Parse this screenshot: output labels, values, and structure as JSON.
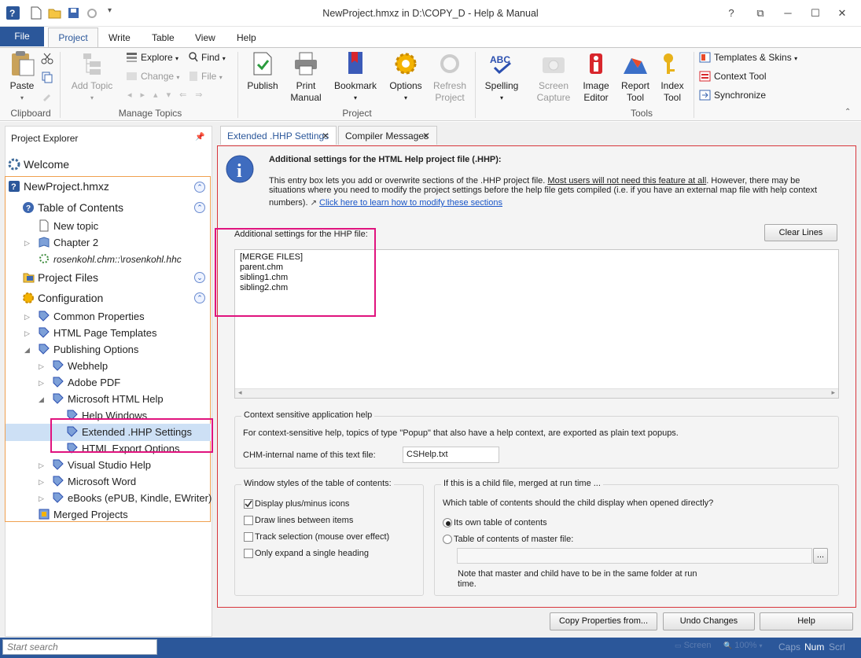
{
  "window": {
    "title": "NewProject.hmxz in D:\\COPY_D - Help & Manual",
    "help_btn": "?",
    "restore_btn": "⧉",
    "minimize_btn": "─",
    "maximize_btn": "☐",
    "close_btn": "✕"
  },
  "ribbon_tabs": {
    "file": "File",
    "project": "Project",
    "write": "Write",
    "table": "Table",
    "view": "View",
    "help": "Help"
  },
  "ribbon": {
    "clipboard": {
      "label": "Clipboard",
      "paste": "Paste"
    },
    "manage_topics": {
      "label": "Manage Topics",
      "add_topic": "Add Topic",
      "explore": "Explore",
      "find": "Find",
      "change": "Change",
      "file": "File"
    },
    "project": {
      "label": "Project",
      "publish": "Publish",
      "print_manual_1": "Print",
      "print_manual_2": "Manual",
      "bookmark": "Bookmark",
      "options": "Options",
      "refresh_1": "Refresh",
      "refresh_2": "Project"
    },
    "tools": {
      "label": "Tools",
      "spelling": "Spelling",
      "screen_capture_1": "Screen",
      "screen_capture_2": "Capture",
      "image_editor_1": "Image",
      "image_editor_2": "Editor",
      "report_tool_1": "Report",
      "report_tool_2": "Tool",
      "index_tool_1": "Index",
      "index_tool_2": "Tool",
      "templates_skins": "Templates & Skins",
      "context_tool": "Context Tool",
      "synchronize": "Synchronize"
    }
  },
  "explorer": {
    "title": "Project Explorer",
    "welcome": "Welcome",
    "project": "NewProject.hmxz",
    "toc": "Table of Contents",
    "new_topic": "New topic",
    "chapter2": "Chapter 2",
    "rosenkohl": "rosenkohl.chm::\\rosenkohl.hhc",
    "project_files": "Project Files",
    "configuration": "Configuration",
    "common_properties": "Common Properties",
    "html_page_templates": "HTML Page Templates",
    "publishing_options": "Publishing Options",
    "webhelp": "Webhelp",
    "adobe_pdf": "Adobe PDF",
    "ms_html_help": "Microsoft HTML Help",
    "help_windows": "Help Windows",
    "extended_hhp": "Extended .HHP Settings",
    "html_export": "HTML Export Options",
    "visual_studio_help": "Visual Studio Help",
    "ms_word": "Microsoft Word",
    "ebooks": "eBooks (ePUB, Kindle, EWriter)",
    "merged_projects": "Merged Projects"
  },
  "doc_tabs": {
    "extended": "Extended .HHP Settings",
    "compiler": "Compiler Messages"
  },
  "content": {
    "heading": "Additional settings for the HTML Help project file (.HHP):",
    "desc_1": "This entry box lets you add or overwrite sections of the .HHP project file.",
    "desc_underlined": "Most users will not need this feature at all",
    "desc_2": ". However, there may be",
    "desc_3": "situations where you need to modify the project settings before the help file gets compiled (i.e. if you have an external map file with help context",
    "desc_4": "numbers).",
    "desc_link": "Click here to learn how to modify these sections",
    "hhp_label": "Additional settings for the HHP file:",
    "clear_lines": "Clear Lines",
    "hhp_lines": [
      "[MERGE FILES]",
      "parent.chm",
      "sibling1.chm",
      "sibling2.chm"
    ],
    "context_group": "Context sensitive application help",
    "context_desc": "For context-sensitive help, topics of type \"Popup\" that also have a help context, are exported as plain text popups.",
    "chm_internal_label": "CHM-internal name of this text file:",
    "chm_internal_value": "CSHelp.txt",
    "window_styles_group": "Window styles of the table of contents:",
    "display_plus_minus": "Display plus/minus icons",
    "draw_lines": "Draw lines between items",
    "track_selection": "Track selection (mouse over effect)",
    "only_expand": "Only expand a single heading",
    "child_group": "If this is a child file, merged at run time ...",
    "child_question": "Which table of contents should the child display when opened directly?",
    "its_own_toc": "Its own table of contents",
    "master_toc": "Table of contents of  master file:",
    "browse": "...",
    "note_1": "Note that master and child have to be in the same folder at run",
    "note_2": "time."
  },
  "footer_buttons": {
    "copy_properties": "Copy Properties from...",
    "undo_changes": "Undo Changes",
    "help": "Help"
  },
  "statusbar": {
    "search_placeholder": "Start search",
    "screen": "Screen",
    "zoom": "100%",
    "caps": "Caps",
    "num": "Num",
    "scrl": "Scrl"
  },
  "colors": {
    "accent": "#2b579a",
    "highlight": "#e0137e",
    "link": "#1a56c8",
    "panel_border": "#d8363c"
  }
}
